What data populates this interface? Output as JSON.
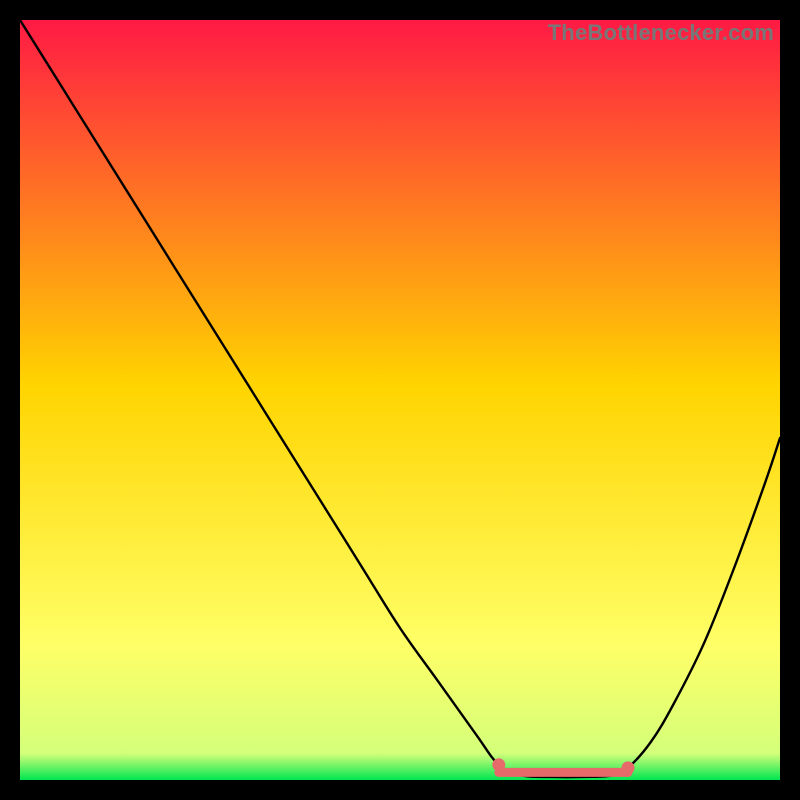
{
  "attribution": "TheBottlenecker.com",
  "colors": {
    "top": "#ff1a44",
    "mid": "#ffd400",
    "low": "#ffff66",
    "bottom": "#00e651",
    "curve": "#000000",
    "marker": "#e76a6a",
    "frame": "#000000"
  },
  "chart_data": {
    "type": "line",
    "title": "",
    "xlabel": "",
    "ylabel": "",
    "xlim": [
      0,
      100
    ],
    "ylim": [
      0,
      100
    ],
    "series": [
      {
        "name": "bottleneck-curve",
        "x": [
          0,
          5,
          10,
          15,
          20,
          25,
          30,
          35,
          40,
          45,
          50,
          55,
          60,
          63,
          66,
          70,
          74,
          78,
          80,
          83,
          86,
          90,
          94,
          98,
          100
        ],
        "values": [
          100,
          92,
          84,
          76,
          68,
          60,
          52,
          44,
          36,
          28,
          20,
          13,
          6,
          2,
          0.6,
          0.4,
          0.4,
          0.6,
          1.6,
          5,
          10,
          18,
          28,
          39,
          45
        ]
      }
    ],
    "markers": [
      {
        "name": "flat-region-start",
        "x": 63,
        "y": 2.0
      },
      {
        "name": "flat-region-end",
        "x": 80,
        "y": 1.6
      }
    ],
    "flat_region": {
      "x_start": 63,
      "x_end": 80,
      "y": 1.0
    },
    "background_gradient_stops": [
      {
        "offset": 0.0,
        "color": "#ff1a44"
      },
      {
        "offset": 0.48,
        "color": "#ffd400"
      },
      {
        "offset": 0.82,
        "color": "#ffff66"
      },
      {
        "offset": 0.965,
        "color": "#d4ff7a"
      },
      {
        "offset": 1.0,
        "color": "#00e651"
      }
    ]
  }
}
